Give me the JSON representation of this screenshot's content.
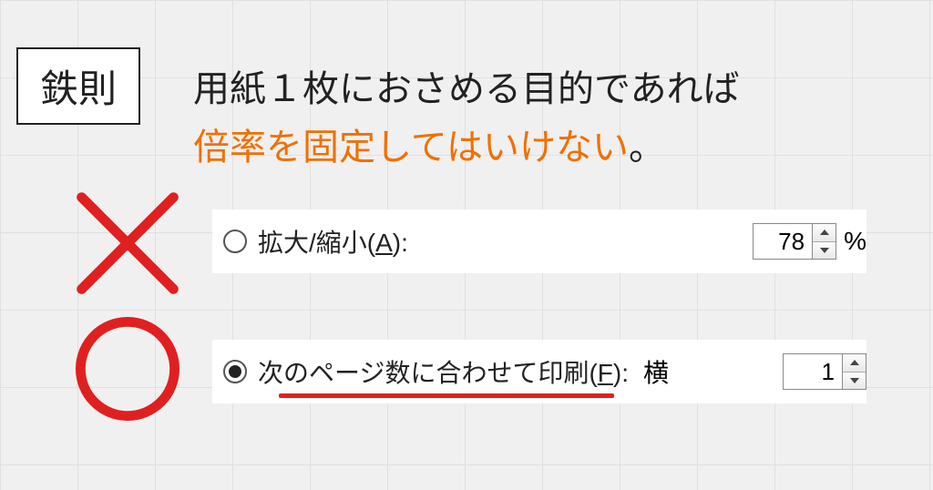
{
  "badge": "鉄則",
  "heading_line1": "用紙１枚におさめる目的であれば",
  "heading_line2_a": "倍率を固定してはいけない",
  "heading_line2_b": "。",
  "option1": {
    "label_pre": "拡大/縮小(",
    "label_key": "A",
    "label_post": "):",
    "value": "78",
    "unit": "%"
  },
  "option2": {
    "label_pre": "次のページ数に合わせて印刷(",
    "label_key": "F",
    "label_post": "):",
    "trail": "横",
    "value": "1"
  }
}
